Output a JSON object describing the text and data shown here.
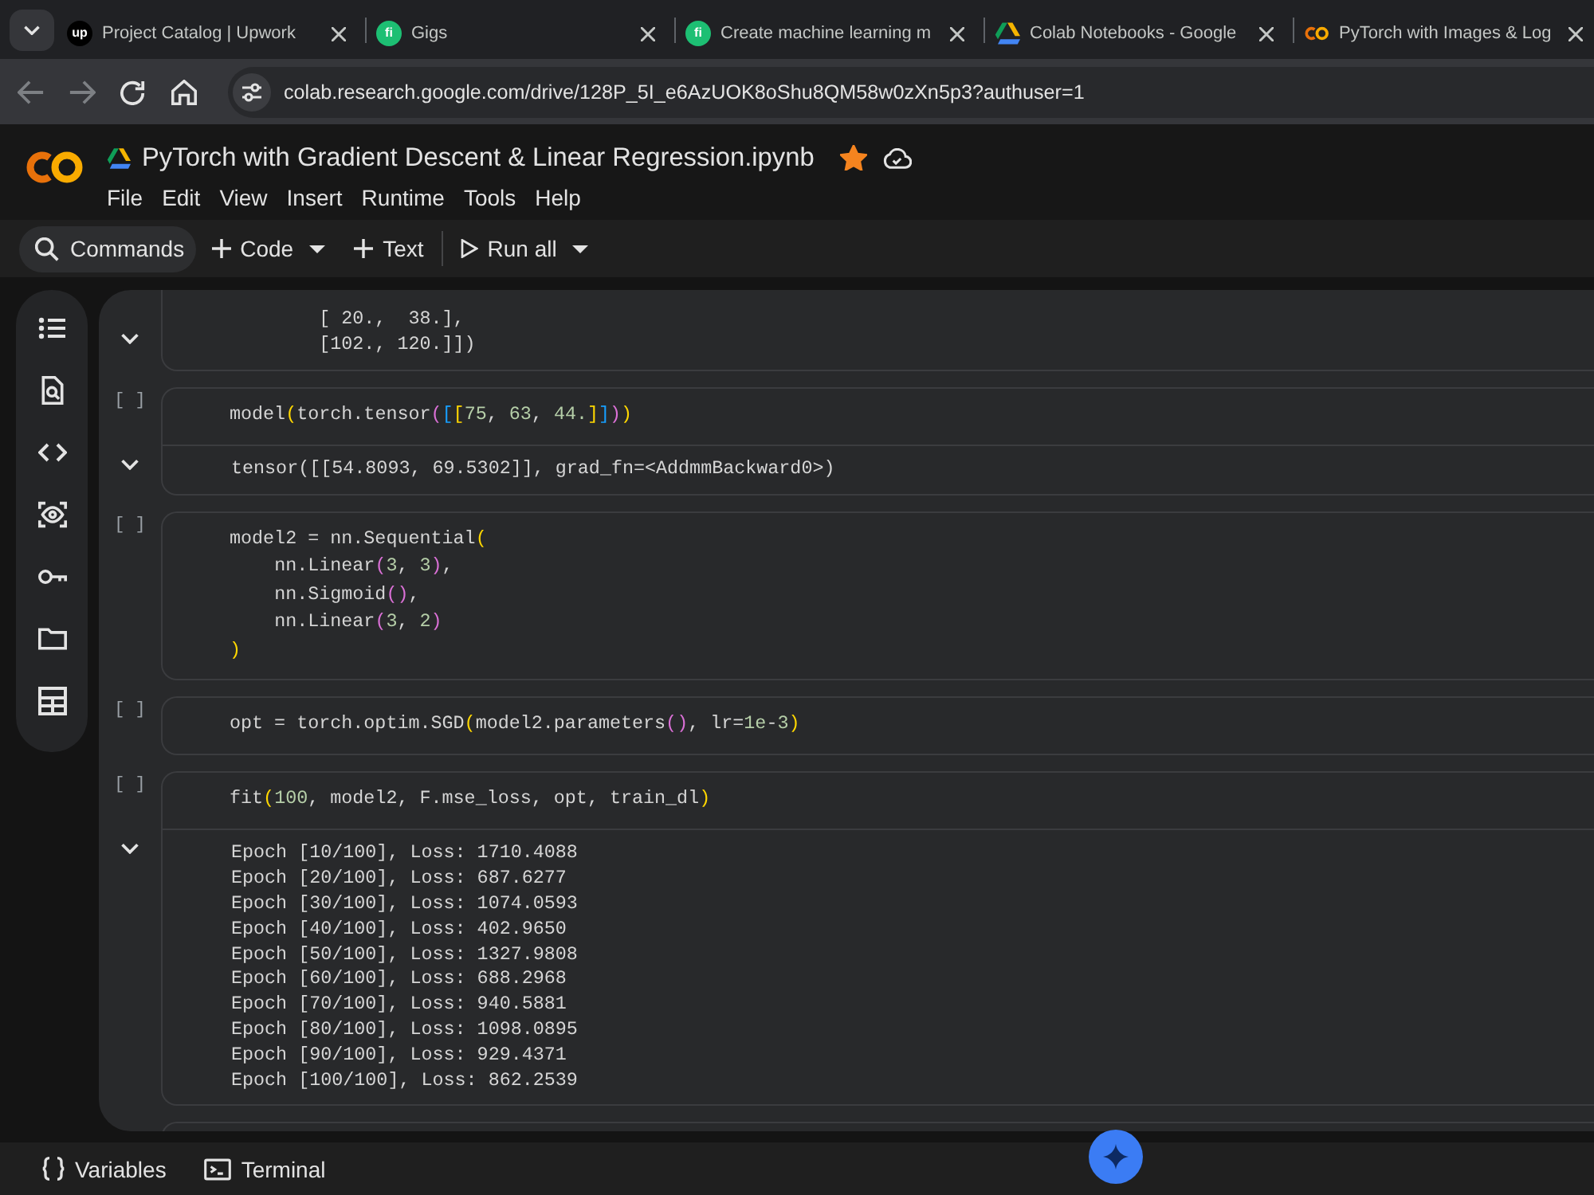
{
  "browser": {
    "tabs": [
      {
        "title": "Project Catalog | Upwork",
        "selected": false,
        "favicon": {
          "kind": "letters",
          "text": "up",
          "color": "#000000"
        }
      },
      {
        "title": "Gigs",
        "selected": false,
        "favicon": {
          "kind": "letters",
          "text": "fi",
          "color": "#1dbf73"
        }
      },
      {
        "title": "Create machine learning m",
        "selected": false,
        "favicon": {
          "kind": "letters",
          "text": "fi",
          "color": "#1dbf73"
        }
      },
      {
        "title": "Colab Notebooks - Google",
        "selected": false,
        "favicon": {
          "kind": "drive"
        }
      },
      {
        "title": "PyTorch with Images & Log",
        "selected": false,
        "favicon": {
          "kind": "colab"
        }
      }
    ],
    "nav_buttons": [
      {
        "kind": "back",
        "disabled": true
      },
      {
        "kind": "forward",
        "disabled": true
      },
      {
        "kind": "reload",
        "disabled": false
      },
      {
        "kind": "home",
        "disabled": false
      }
    ],
    "address": "colab.research.google.com/drive/128P_5I_e6AzUOK8oShu8QM58w0zXn5p3?authuser=1"
  },
  "colab": {
    "title": "PyTorch with Gradient Descent & Linear Regression.ipynb",
    "starred": true,
    "menu": [
      "File",
      "Edit",
      "View",
      "Insert",
      "Runtime",
      "Tools",
      "Help"
    ],
    "toolbar": [
      {
        "kind": "search",
        "label": "Commands",
        "dropdown": false
      },
      {
        "kind": "add",
        "label": "Code",
        "dropdown": true
      },
      {
        "kind": "add",
        "label": "Text",
        "dropdown": false
      },
      {
        "kind": "run",
        "label": "Run all",
        "dropdown": true
      }
    ]
  },
  "sidebar": {
    "items": [
      {
        "kind": "toc"
      },
      {
        "kind": "find"
      },
      {
        "kind": "snippets"
      },
      {
        "kind": "inspector"
      },
      {
        "kind": "secrets"
      },
      {
        "kind": "files"
      },
      {
        "kind": "table"
      }
    ]
  },
  "cells": [
    {
      "output": [
        "        [ 20.,  38.],",
        "        [102., 120.]])"
      ]
    },
    {
      "run_label": "[ ]",
      "code": [
        "model(torch.tensor([[75, 63, 44.]]))"
      ],
      "output": [
        "tensor([[54.8093, 69.5302]], grad_fn=<AddmmBackward0>)"
      ]
    },
    {
      "run_label": "[ ]",
      "code": [
        "model2 = nn.Sequential(",
        "    nn.Linear(3, 3),",
        "    nn.Sigmoid(),",
        "    nn.Linear(3, 2)",
        ")"
      ]
    },
    {
      "run_label": "[ ]",
      "code": [
        "opt = torch.optim.SGD(model2.parameters(), lr=1e-3)"
      ]
    },
    {
      "run_label": "[ ]",
      "code": [
        "fit(100, model2, F.mse_loss, opt, train_dl)"
      ],
      "output": [
        "Epoch [10/100], Loss: 1710.4088",
        "Epoch [20/100], Loss: 687.6277",
        "Epoch [30/100], Loss: 1074.0593",
        "Epoch [40/100], Loss: 402.9650",
        "Epoch [50/100], Loss: 1327.9808",
        "Epoch [60/100], Loss: 688.2968",
        "Epoch [70/100], Loss: 940.5881",
        "Epoch [80/100], Loss: 1098.0895",
        "Epoch [90/100], Loss: 929.4371",
        "Epoch [100/100], Loss: 862.2539"
      ]
    }
  ],
  "bottom_bar": {
    "items": [
      {
        "kind": "variables",
        "label": "Variables"
      },
      {
        "kind": "terminal",
        "label": "Terminal"
      }
    ]
  }
}
